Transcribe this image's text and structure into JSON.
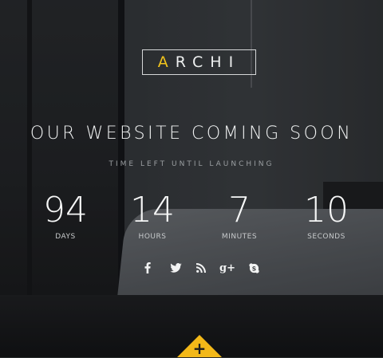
{
  "brand": {
    "logo_first": "A",
    "logo_rest": "RCHI",
    "accent_color": "#f2c41c"
  },
  "hero": {
    "title": "OUR WEBSITE COMING SOON",
    "subtitle": "TIME LEFT UNTIL LAUNCHING"
  },
  "countdown": [
    {
      "value": "94",
      "label": "DAYS"
    },
    {
      "value": "14",
      "label": "HOURS"
    },
    {
      "value": "7",
      "label": "MINUTES"
    },
    {
      "value": "10",
      "label": "SECONDS"
    }
  ],
  "social": {
    "icons": [
      "facebook-icon",
      "twitter-icon",
      "rss-icon",
      "google-plus-icon",
      "skype-icon"
    ],
    "google_plus_glyph": "g+"
  },
  "toggle": {
    "glyph": "+",
    "color": "#f3b818"
  }
}
